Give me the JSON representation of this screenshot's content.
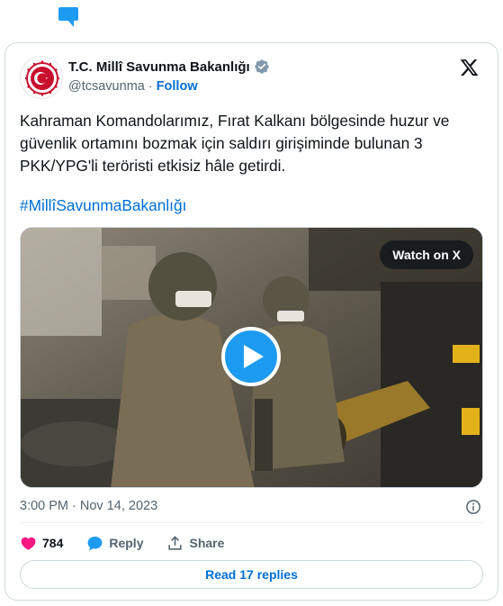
{
  "tweet": {
    "author": {
      "display_name": "T.C. Millî Savunma Bakanlığı",
      "handle": "@tcsavunma",
      "follow_label": "Follow",
      "separator": "·"
    },
    "text": "Kahraman Komandolarımız, Fırat Kalkanı bölgesinde huzur ve güvenlik ortamını bozmak için saldırı girişiminde bulunan 3 PKK/YPG'li teröristi etkisiz hâle getirdi.",
    "hashtag": "#MillîSavunmaBakanlığı",
    "media": {
      "watch_label": "Watch on X"
    },
    "timestamp": "3:00 PM · Nov 14, 2023"
  },
  "actions": {
    "likes": "784",
    "reply_label": "Reply",
    "share_label": "Share"
  },
  "read_replies_label": "Read 17 replies",
  "icons": {
    "top": "comment-icon",
    "verified": "verified-icon",
    "brand": "x-logo-icon",
    "info": "info-icon",
    "like": "heart-icon",
    "reply": "reply-bubble-icon",
    "share": "share-icon",
    "play": "play-icon"
  },
  "colors": {
    "accent": "#1d9bf0",
    "link": "#006fd6",
    "like": "#f91880",
    "text": "#0f1419",
    "muted": "#536471",
    "border": "#cfd9de"
  }
}
